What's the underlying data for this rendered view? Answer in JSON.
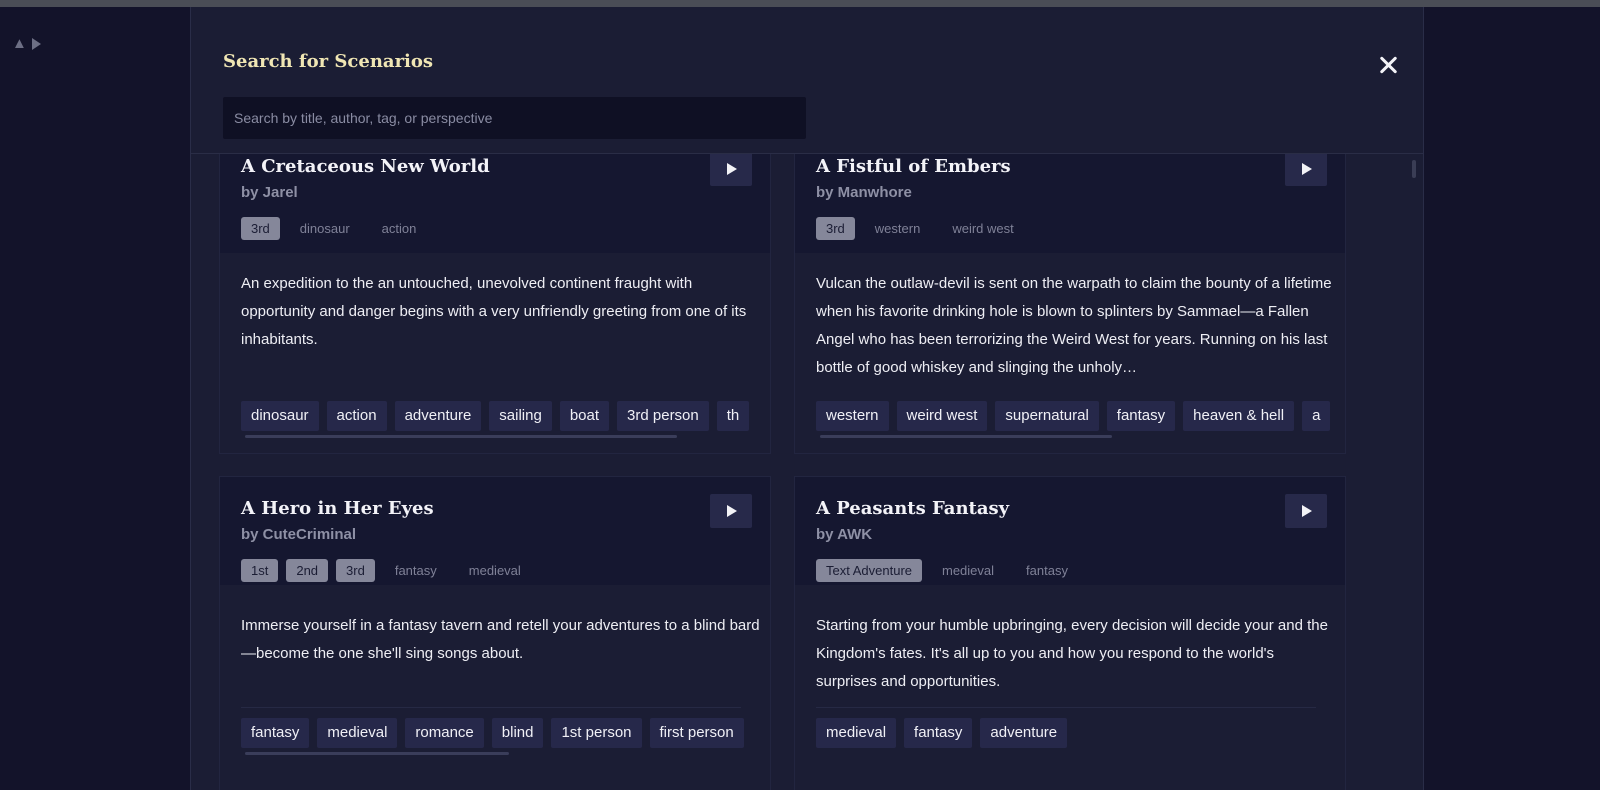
{
  "modal": {
    "title": "Search for Scenarios",
    "search_placeholder": "Search by title, author, tag, or perspective",
    "search_value": ""
  },
  "cards": [
    {
      "title": "A Cretaceous New World",
      "author": "by Jarel",
      "perspectives": [
        "3rd"
      ],
      "header_tags": [
        "dinosaur",
        "action"
      ],
      "description": "An expedition to the an untouched, unevolved continent fraught with opportunity and danger begins with a very unfriendly greeting from one of its inhabitants.",
      "tags": [
        "dinosaur",
        "action",
        "adventure",
        "sailing",
        "boat",
        "3rd person",
        "th"
      ]
    },
    {
      "title": "A Fistful of Embers",
      "author": "by Manwhore",
      "perspectives": [
        "3rd"
      ],
      "header_tags": [
        "western",
        "weird west"
      ],
      "description": "Vulcan the outlaw-devil is sent on the warpath to claim the bounty of a lifetime when his favorite drinking hole is blown to splinters by Sammael—a Fallen Angel who has been terrorizing the Weird West for years. Running on his last bottle of good whiskey and slinging the unholy…",
      "tags": [
        "western",
        "weird west",
        "supernatural",
        "fantasy",
        "heaven & hell",
        "a"
      ]
    },
    {
      "title": "A Hero in Her Eyes",
      "author": "by CuteCriminal",
      "perspectives": [
        "1st",
        "2nd",
        "3rd"
      ],
      "header_tags": [
        "fantasy",
        "medieval"
      ],
      "description": "Immerse yourself in a fantasy tavern and retell your adventures to a blind bard—become the one she'll sing songs about.",
      "tags": [
        "fantasy",
        "medieval",
        "romance",
        "blind",
        "1st person",
        "first person"
      ]
    },
    {
      "title": "A Peasants Fantasy",
      "author": "by AWK",
      "perspectives": [
        "Text Adventure"
      ],
      "header_tags": [
        "medieval",
        "fantasy"
      ],
      "description": "Starting from your humble upbringing, every decision will decide your and the Kingdom's fates. It's all up to you and how you respond to the world's surprises and opportunities.",
      "tags": [
        "medieval",
        "fantasy",
        "adventure"
      ]
    }
  ]
}
